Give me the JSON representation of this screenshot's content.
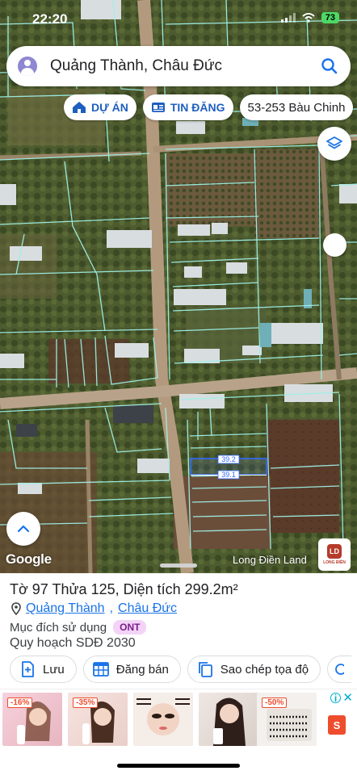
{
  "status_bar": {
    "time": "22:20",
    "battery": "73"
  },
  "search": {
    "query": "Quảng Thành, Châu Đức"
  },
  "chips": [
    {
      "label": "DỰ ÁN",
      "icon": "house-icon"
    },
    {
      "label": "TIN ĐĂNG",
      "icon": "newspaper-icon"
    },
    {
      "label": "53-253 Bàu Chinh",
      "icon": ""
    }
  ],
  "map": {
    "plot_labels": [
      "39.2",
      "39.1"
    ],
    "google_logo": "Google",
    "brand_name": "Long Điền Land",
    "brand_logo_text": "LONG ĐIỀN",
    "brand_logo_mark": "LD"
  },
  "parcel": {
    "title": "Tờ 97 Thửa 125, Diện tích 299.2m²",
    "ward": "Quảng Thành",
    "district": "Châu Đức",
    "purpose_label": "Mục đích sử dụng",
    "purpose_code": "ONT",
    "planning": "Quy hoạch SDĐ 2030"
  },
  "actions": [
    {
      "label": "Lưu",
      "icon": "bookmark-add-icon"
    },
    {
      "label": "Đăng bán",
      "icon": "calendar-grid-icon"
    },
    {
      "label": "Sao chép tọa độ",
      "icon": "copy-icon"
    }
  ],
  "ad": {
    "discounts": [
      "-16%",
      "-35%",
      "",
      "",
      "-50%"
    ],
    "info": "i",
    "close": "✕",
    "shop_letter": "S"
  },
  "colors": {
    "accent": "#1a73e8",
    "parcel_line": "#9ff0e6",
    "highlight": "#2f6bff",
    "badge_bg": "#f3d4f7"
  }
}
